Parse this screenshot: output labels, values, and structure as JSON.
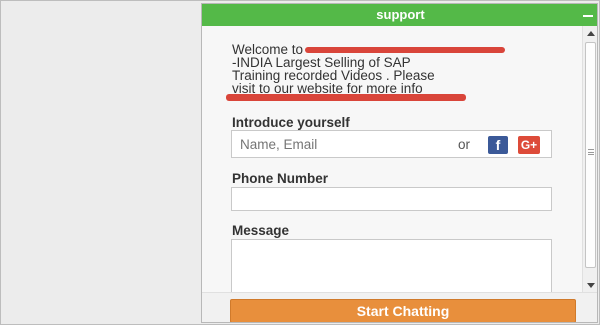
{
  "widget": {
    "title": "support",
    "minimize_icon": "minimize-icon"
  },
  "welcome": {
    "line1_prefix": "Welcome to",
    "lines": [
      "-INDIA  Largest Selling of SAP",
      "Training recorded Videos . Please",
      "visit to our website for more info"
    ],
    "redaction_color": "#d9453a"
  },
  "intro": {
    "label": "Introduce yourself",
    "placeholder": "Name, Email",
    "or_text": "or",
    "facebook_glyph": "f",
    "google_glyph": "G+"
  },
  "phone": {
    "label": "Phone Number",
    "value": ""
  },
  "message": {
    "label": "Message",
    "value": ""
  },
  "footer": {
    "button_label": "Start Chatting"
  },
  "colors": {
    "header_green": "#54b948",
    "button_orange": "#e88f3c",
    "facebook_blue": "#3b5998",
    "google_red": "#dd4b39"
  }
}
